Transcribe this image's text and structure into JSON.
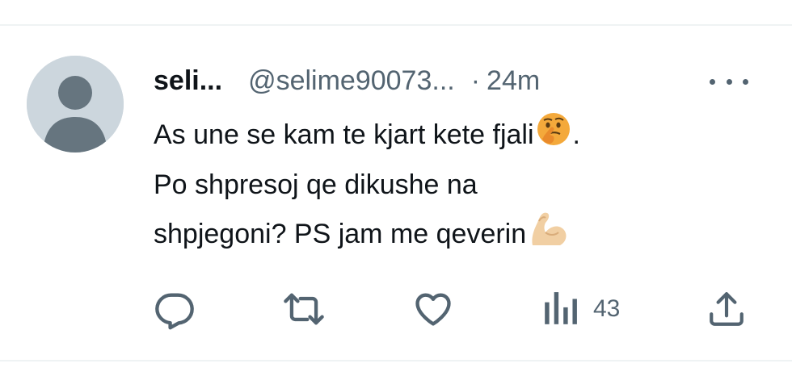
{
  "tweet": {
    "author_name": "seli...",
    "author_handle": "@selime90073...",
    "separator": "·",
    "time": "24m",
    "text_lines": [
      "As une se kam te kjart kete fjali",
      "Po shpresoj qe dikushe na",
      "shpjegoni? PS jam me qeverin"
    ],
    "line1_suffix": ".",
    "emojis": [
      "thinking-face",
      "flexed-biceps"
    ],
    "views": "43"
  },
  "icons": {
    "more": "more-icon",
    "reply": "reply-icon",
    "retweet": "retweet-icon",
    "like": "like-icon",
    "views": "views-icon",
    "share": "share-icon"
  },
  "colors": {
    "text": "#0f1419",
    "muted": "#536471",
    "avatar_bg": "#ccd6dd",
    "avatar_fg": "#66757f",
    "border": "#eff3f4"
  }
}
